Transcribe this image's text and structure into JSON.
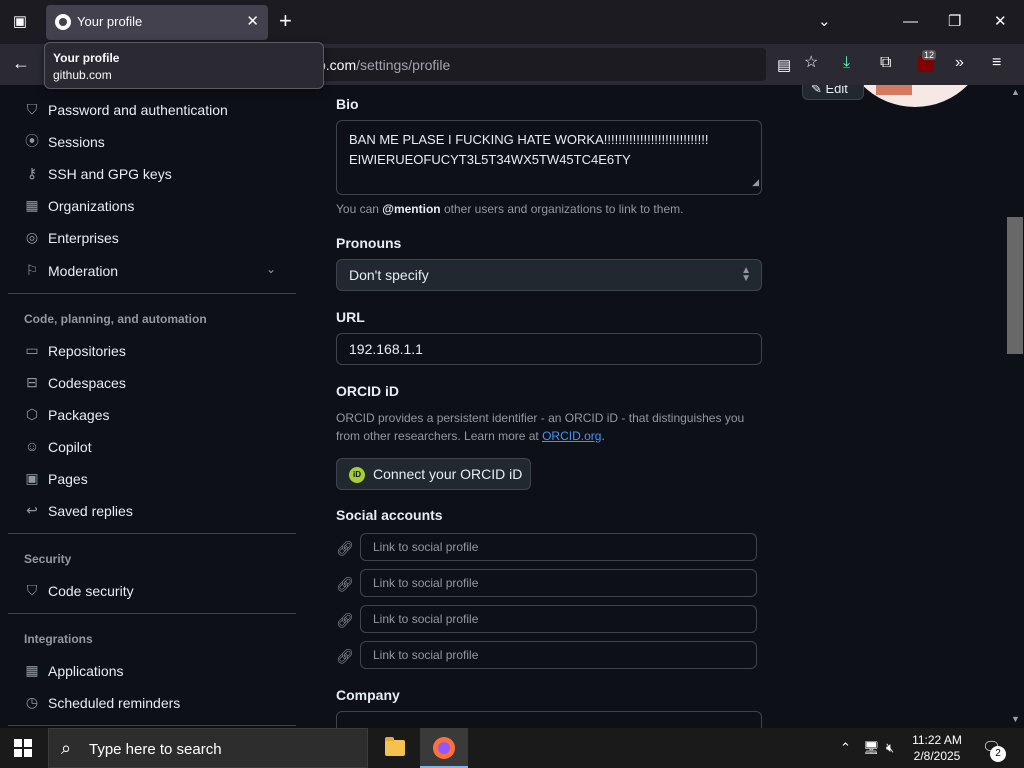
{
  "browser": {
    "tab_title": "Your profile",
    "tooltip": {
      "title": "Your profile",
      "url": "github.com"
    },
    "url_host": "b.com",
    "url_path": "/settings/profile",
    "extension_badge": "12"
  },
  "sidebar": {
    "items_top": [
      {
        "label": "Password and authentication",
        "icon": "shield-lock-icon"
      },
      {
        "label": "Sessions",
        "icon": "broadcast-icon"
      },
      {
        "label": "SSH and GPG keys",
        "icon": "key-icon"
      },
      {
        "label": "Organizations",
        "icon": "organization-icon"
      },
      {
        "label": "Enterprises",
        "icon": "globe-icon"
      },
      {
        "label": "Moderation",
        "icon": "report-icon"
      }
    ],
    "section_code": "Code, planning, and automation",
    "items_code": [
      {
        "label": "Repositories",
        "icon": "repo-icon"
      },
      {
        "label": "Codespaces",
        "icon": "codespaces-icon"
      },
      {
        "label": "Packages",
        "icon": "package-icon"
      },
      {
        "label": "Copilot",
        "icon": "copilot-icon"
      },
      {
        "label": "Pages",
        "icon": "browser-icon"
      },
      {
        "label": "Saved replies",
        "icon": "reply-icon"
      }
    ],
    "section_security": "Security",
    "items_security": [
      {
        "label": "Code security",
        "icon": "shield-icon"
      }
    ],
    "section_integrations": "Integrations",
    "items_integrations": [
      {
        "label": "Applications",
        "icon": "apps-icon"
      },
      {
        "label": "Scheduled reminders",
        "icon": "clock-icon"
      }
    ]
  },
  "profile": {
    "edit_label": "Edit",
    "bio_label": "Bio",
    "bio_value": "BAN ME PLASE I FUCKING HATE WORKA!!!!!!!!!!!!!!!!!!!!!!!!!!!!!\nEIWIERUEOFUCYT3L5T34WX5TW45TC4E6TY",
    "bio_note_prefix": "You can ",
    "bio_note_mention": "@mention",
    "bio_note_suffix": " other users and organizations to link to them.",
    "pronouns_label": "Pronouns",
    "pronouns_value": "Don't specify",
    "url_label": "URL",
    "url_value": "192.168.1.1",
    "orcid_label": "ORCID iD",
    "orcid_desc": "ORCID provides a persistent identifier - an ORCID iD - that distinguishes you from other researchers. Learn more at ",
    "orcid_link": "ORCID.org",
    "orcid_desc_end": ".",
    "orcid_button": "Connect your ORCID iD",
    "orcid_icon_text": "iD",
    "social_label": "Social accounts",
    "social_placeholder": "Link to social profile",
    "company_label": "Company"
  },
  "taskbar": {
    "search_placeholder": "Type here to search",
    "time": "11:22 AM",
    "date": "2/8/2025",
    "notification_count": "2"
  }
}
